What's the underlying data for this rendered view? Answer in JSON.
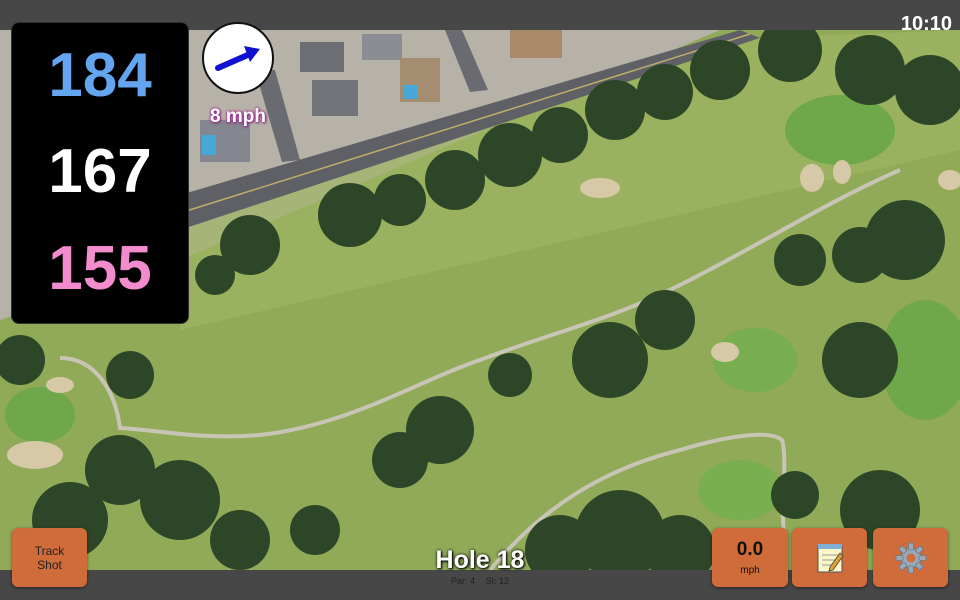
{
  "status_bar": {
    "time": "10:10"
  },
  "distances": {
    "back": "184",
    "middle": "167",
    "front": "155"
  },
  "wind": {
    "speed_label": "8 mph",
    "direction_icon": "arrow-right-icon"
  },
  "hole": {
    "title": "Hole 18",
    "par_label": "Par: 4",
    "si_label": "SI: 12"
  },
  "buttons": {
    "track_shot_line1": "Track",
    "track_shot_line2": "Shot",
    "speed_value": "0.0",
    "speed_unit": "mph",
    "notes_icon": "notepad-icon",
    "settings_icon": "gear-icon"
  },
  "colors": {
    "back": "#63a6ef",
    "middle": "#ffffff",
    "front": "#f28ccc",
    "button": "#d06b3a",
    "bar": "#474747",
    "fairway": "#8fa85a"
  }
}
